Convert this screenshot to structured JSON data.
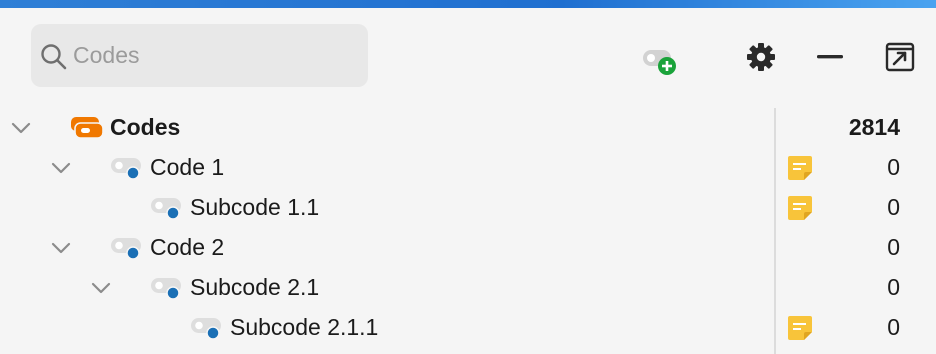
{
  "search": {
    "placeholder": "Codes",
    "icon": "search-icon"
  },
  "toolbar": {
    "new_code_icon": "new-code-icon",
    "settings_icon": "gear-icon",
    "minimize_icon": "minimize-icon",
    "undock_icon": "undock-icon",
    "accent_green": "#1aa33a"
  },
  "tree": {
    "root": {
      "label": "Codes",
      "count": "2814",
      "icon_color": "#f07800",
      "expanded": true
    },
    "items": [
      {
        "label": "Code 1",
        "count": "0",
        "memo": true,
        "expanded": true,
        "dot_color": "#1a6fb5"
      },
      {
        "label": "Subcode 1.1",
        "count": "0",
        "memo": true,
        "dot_color": "#1a6fb5"
      },
      {
        "label": "Code 2",
        "count": "0",
        "memo": false,
        "expanded": true,
        "dot_color": "#1a6fb5"
      },
      {
        "label": "Subcode 2.1",
        "count": "0",
        "memo": false,
        "expanded": true,
        "dot_color": "#1a6fb5"
      },
      {
        "label": "Subcode 2.1.1",
        "count": "0",
        "memo": true,
        "dot_color": "#1a6fb5"
      }
    ],
    "memo_color": "#f8c43a"
  }
}
